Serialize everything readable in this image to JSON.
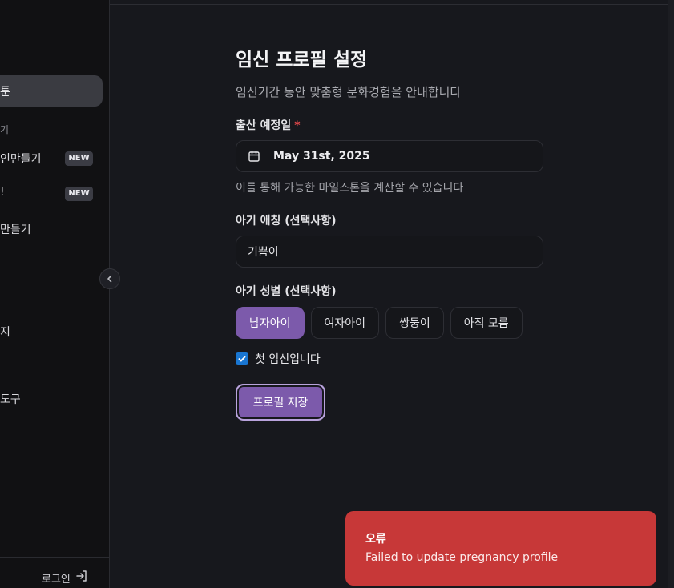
{
  "sidebar": {
    "active_item": "툰",
    "section_label": "기",
    "items": [
      {
        "label": "인만들기",
        "badge": "NEW"
      },
      {
        "label": "!",
        "badge": "NEW"
      },
      {
        "label": "만들기",
        "badge": ""
      },
      {
        "label": "지",
        "badge": ""
      },
      {
        "label": "도구",
        "badge": ""
      }
    ],
    "login_label": "로그인"
  },
  "form": {
    "title": "임신 프로필 설정",
    "subtitle": "임신기간 동안 맞춤형 문화경험을 안내합니다",
    "due_date_label": "출산 예정일",
    "required_mark": "*",
    "due_date_value": "May 31st, 2025",
    "due_date_hint": "이를 통해 가능한 마일스톤을 계산할 수 있습니다",
    "nickname_label": "아기 애칭 (선택사항)",
    "nickname_value": "기쁨이",
    "gender_label": "아기 성별 (선택사항)",
    "gender_options": [
      "남자아이",
      "여자아이",
      "쌍둥이",
      "아직 모름"
    ],
    "gender_selected": "남자아이",
    "first_pregnancy_label": "첫 임신입니다",
    "first_pregnancy_checked": true,
    "save_label": "프로필 저장"
  },
  "toast": {
    "title": "오류",
    "message": "Failed to update pregnancy profile"
  },
  "colors": {
    "accent": "#7c5aab",
    "error": "#c73838",
    "background": "#17181d",
    "sidebar": "#111113",
    "checkbox": "#1976d2"
  }
}
